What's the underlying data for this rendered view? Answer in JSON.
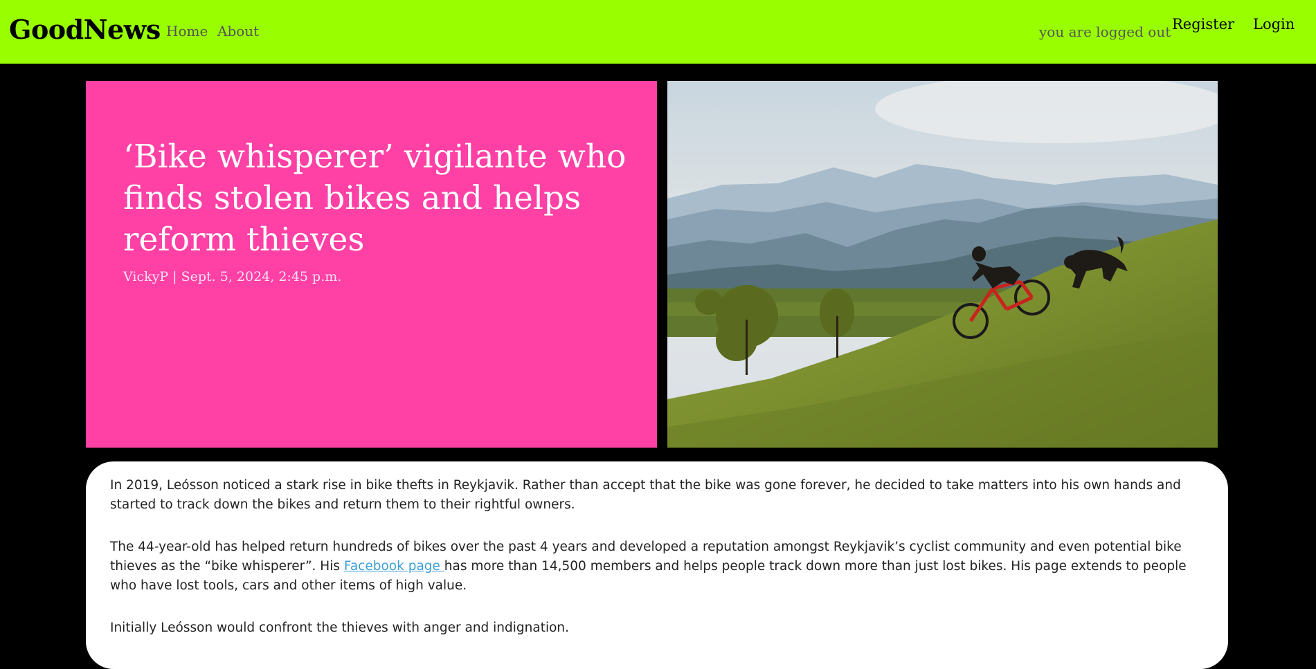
{
  "nav": {
    "brand": "GoodNews",
    "home": "Home",
    "about": "About",
    "status": "you are logged out",
    "register": "Register",
    "login": "Login"
  },
  "article": {
    "title": "‘Bike whisperer’ vigilante who finds stolen bikes and helps reform thieves",
    "byline": "VickyP | Sept. 5, 2024, 2:45 p.m.",
    "image_icon": "photo-mountain-biker-with-dog",
    "paragraphs": [
      "In 2019, Leósson noticed a stark rise in bike thefts in Reykjavik. Rather than accept that the bike was gone forever, he decided to take matters into his own hands and started to track down the bikes and return them to their rightful owners.",
      "The 44-year-old has helped return hundreds of bikes over the past 4 years and developed a reputation amongst Reykjavik’s cyclist community and even potential bike thieves as the “bike whisperer”. His",
      "Facebook page ",
      "has more than 14,500 members and helps people track down more than just lost bikes. His page extends to people who have lost tools, cars and other items of high value.",
      "Initially Leósson would confront the thieves with anger and indignation."
    ]
  },
  "colors": {
    "navbar": "#99ff00",
    "hero_card": "#ff40a5",
    "page_background": "#000000",
    "link": "#3b9fd8"
  }
}
